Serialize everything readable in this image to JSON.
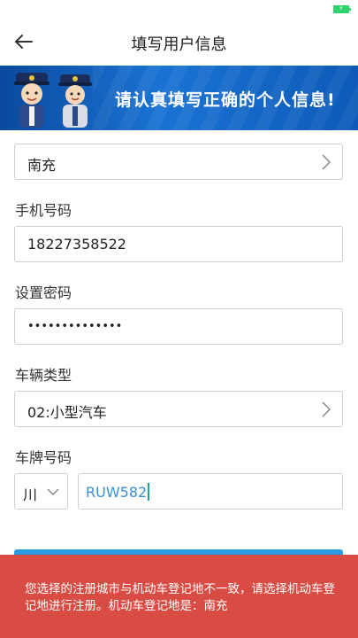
{
  "header": {
    "title": "填写用户信息"
  },
  "banner": {
    "text": "请认真填写正确的个人信息!"
  },
  "form": {
    "city": {
      "value": "南充"
    },
    "phone": {
      "label": "手机号码",
      "value": "18227358522"
    },
    "password": {
      "label": "设置密码",
      "value": "••••••••••••••"
    },
    "vehicle_type": {
      "label": "车辆类型",
      "value": "02:小型汽车"
    },
    "plate": {
      "label": "车牌号码",
      "province": "川",
      "value": "RUW582"
    }
  },
  "toast": {
    "message": "您选择的注册城市与机动车登记地不一致，请选择机动车登记地进行注册。机动车登记地是：南充"
  },
  "colors": {
    "banner": "#0d5ab8",
    "toast": "#d94c43",
    "submit": "#2a9be3",
    "plate_text": "#3a8fd6"
  }
}
